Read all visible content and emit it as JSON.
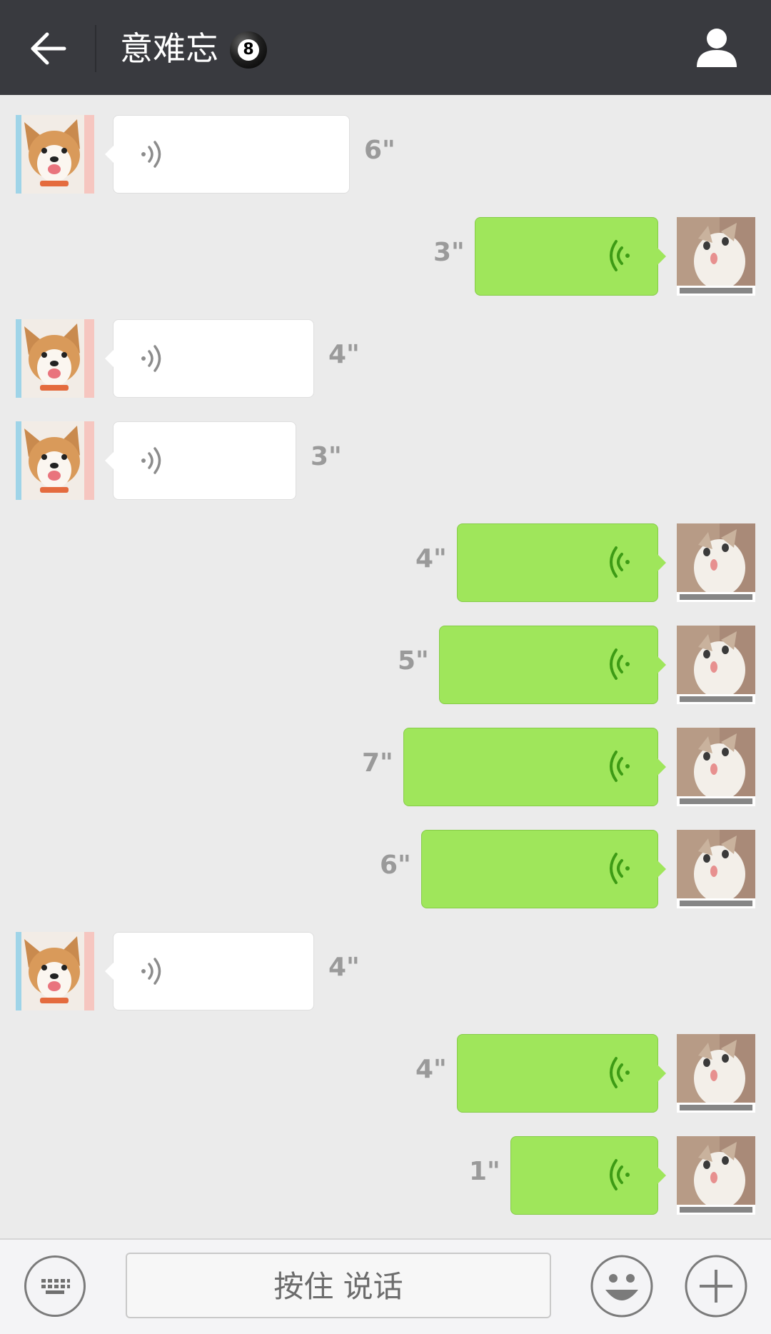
{
  "header": {
    "title": "意难忘",
    "badge": "8",
    "back_icon": "back-arrow-icon",
    "profile_icon": "person-icon"
  },
  "messages": [
    {
      "side": "left",
      "duration": "6\""
    },
    {
      "side": "right",
      "duration": "3\""
    },
    {
      "side": "left",
      "duration": "4\""
    },
    {
      "side": "left",
      "duration": "3\""
    },
    {
      "side": "right",
      "duration": "4\""
    },
    {
      "side": "right",
      "duration": "5\""
    },
    {
      "side": "right",
      "duration": "7\""
    },
    {
      "side": "right",
      "duration": "6\""
    },
    {
      "side": "left",
      "duration": "4\""
    },
    {
      "side": "right",
      "duration": "4\""
    },
    {
      "side": "right",
      "duration": "1\""
    }
  ],
  "input_bar": {
    "hold_to_talk": "按住 说话",
    "keyboard_icon": "keyboard-icon",
    "emoji_icon": "emoji-icon",
    "plus_icon": "plus-icon"
  },
  "colors": {
    "header_bg": "#393a3f",
    "chat_bg": "#ebebeb",
    "sent_bubble": "#9fe65b",
    "received_bubble": "#ffffff"
  }
}
